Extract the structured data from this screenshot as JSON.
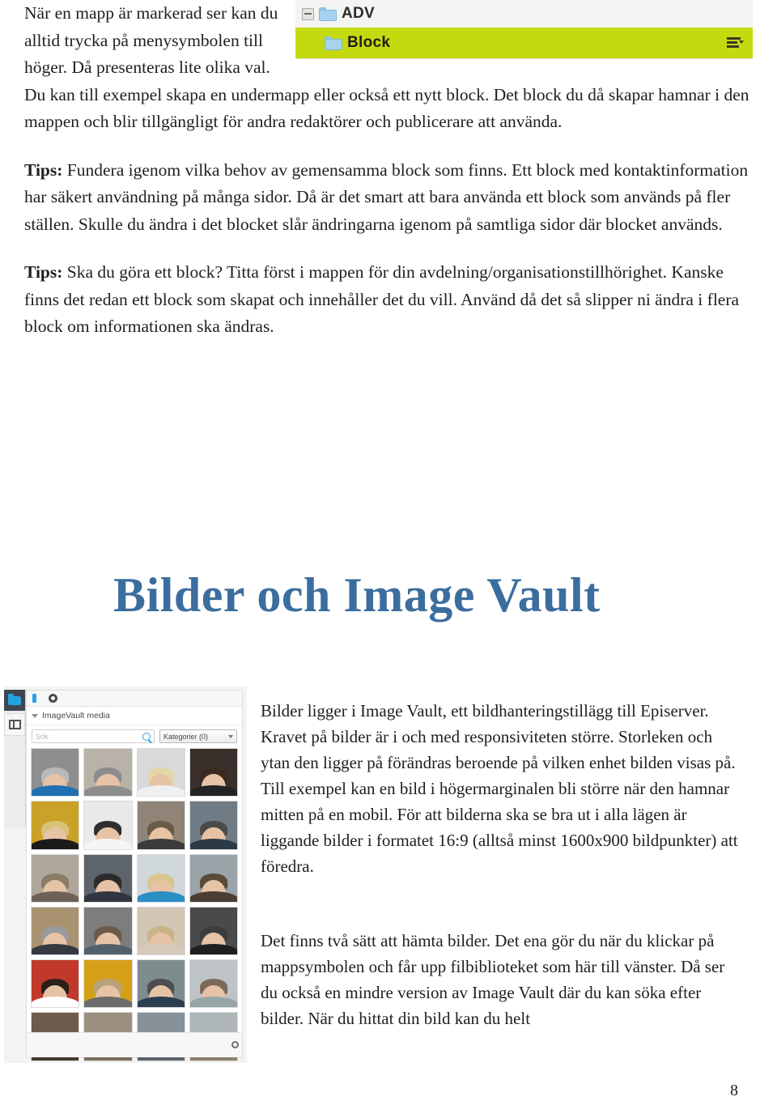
{
  "document": {
    "page_number": "8",
    "heading": "Bilder och Image Vault",
    "accent_color": "#3b6e9e",
    "highlight_color": "#c5da0e"
  },
  "top": {
    "paragraph_1": "När en mapp är markerad ser kan du alltid trycka på menysymbolen till höger. Då presenteras lite olika val. Du kan till exempel skapa en undermapp eller också ett nytt block. Det block du då skapar hamnar i den mappen och blir tillgängligt för andra redaktörer och publicerare att använda.",
    "tips1_label": "Tips:",
    "tips1_text": " Fundera igenom vilka behov av gemensamma block som finns. Ett block med kontaktinformation har säkert användning på många sidor. Då är det smart att bara använda ett block som används på fler ställen. Skulle du ändra i det blocket slår ändringarna igenom på samtliga sidor där blocket används.",
    "tips2_label": "Tips:",
    "tips2_text": " Ska du göra ett block? Titta först i mappen för din avdelning/organisationstillhörighet. Kanske finns det redan ett block som skapat och innehåller det du vill. Använd då det så slipper ni ändra i flera block om informationen ska ändras."
  },
  "tree_screenshot": {
    "rows": [
      {
        "label": "ADV",
        "folder_icon": "folder-icon",
        "expander_icon": "collapse-box-icon",
        "selected": false
      },
      {
        "label": "Block",
        "folder_icon": "folder-icon",
        "menu_icon": "hamburger-menu-icon",
        "selected": true
      }
    ]
  },
  "right_column": {
    "paragraph_1": "Bilder ligger i Image Vault, ett bildhanteringstillägg till Episerver. Kravet på bilder är i och med responsiviteten större. Storleken och ytan den ligger på förändras beroende på vilken enhet bilden visas på. Till exempel kan en bild i högermarginalen bli större när den hamnar mitten på en mobil. För att bilderna ska se bra ut i alla lägen är liggande bilder i formatet 16:9 (alltså minst 1600x900 bildpunkter) att föredra.",
    "paragraph_2": "Det finns två sätt att hämta bilder. Det ena gör du när du klickar på mappsymbolen och får upp filbiblioteket som här till vänster. Då ser du också en  mindre version av Image Vault där du kan söka efter bilder. När du hittat din bild kan du helt"
  },
  "imagevault_panel": {
    "rail": {
      "folder_button_icon": "folder-icon",
      "panel_toggle_icon": "split-pane-icon"
    },
    "toolbar": {
      "pin_icon": "pin-icon",
      "settings_icon": "gear-icon"
    },
    "header": {
      "collapse_icon": "chevron-down-icon",
      "title": "ImageVault media"
    },
    "search": {
      "placeholder": "Sök",
      "value": "",
      "search_icon": "magnifier-icon"
    },
    "category_select": {
      "label": "Kategorier (0)",
      "chevron_icon": "chevron-down-icon"
    },
    "thumbnail_count": 24,
    "footer": {
      "settings_icon": "gear-icon"
    }
  }
}
